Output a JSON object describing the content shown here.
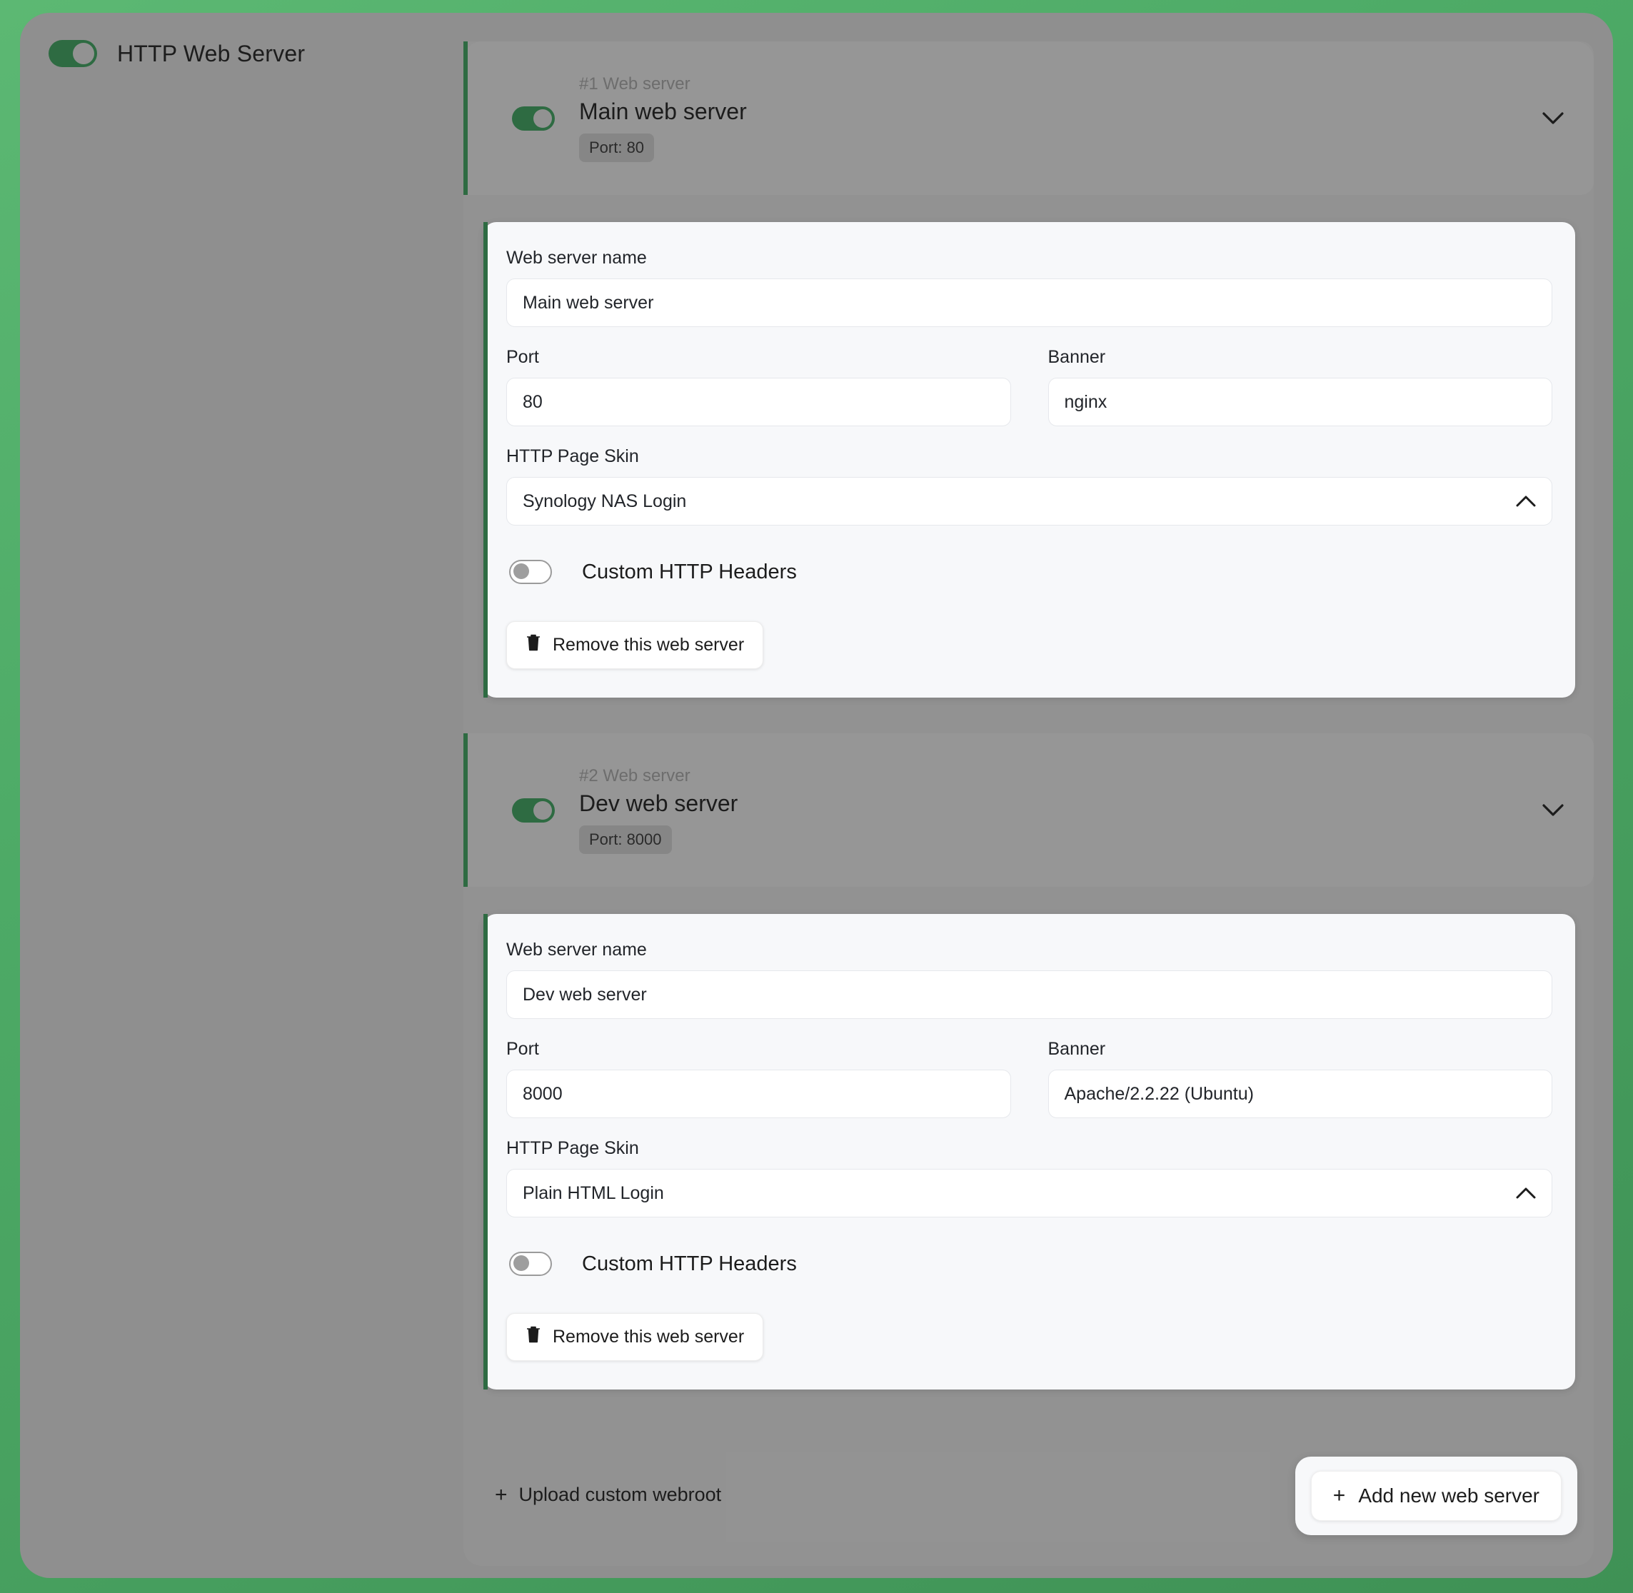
{
  "master": {
    "label": "HTTP Web Server",
    "enabled": true
  },
  "servers": [
    {
      "index_label": "#1 Web server",
      "name": "Main web server",
      "port_badge": "Port: 80",
      "enabled": true,
      "expanded": true,
      "collapse_icon": "chevron-down-icon",
      "form": {
        "name_label": "Web server name",
        "name_value": "Main web server",
        "port_label": "Port",
        "port_value": "80",
        "banner_label": "Banner",
        "banner_value": "nginx",
        "skin_label": "HTTP Page Skin",
        "skin_value": "Synology NAS Login",
        "skin_icon": "chevron-up-icon",
        "headers_label": "Custom HTTP Headers",
        "headers_enabled": false,
        "remove_label": "Remove this web server",
        "remove_icon": "trash-icon"
      }
    },
    {
      "index_label": "#2 Web server",
      "name": "Dev web server",
      "port_badge": "Port: 8000",
      "enabled": true,
      "expanded": true,
      "collapse_icon": "chevron-down-icon",
      "form": {
        "name_label": "Web server name",
        "name_value": "Dev web server",
        "port_label": "Port",
        "port_value": "8000",
        "banner_label": "Banner",
        "banner_value": "Apache/2.2.22 (Ubuntu)",
        "skin_label": "HTTP Page Skin",
        "skin_value": "Plain HTML Login",
        "skin_icon": "chevron-up-icon",
        "headers_label": "Custom HTTP Headers",
        "headers_enabled": false,
        "remove_label": "Remove this web server",
        "remove_icon": "trash-icon"
      }
    }
  ],
  "footer": {
    "upload_label": "Upload custom webroot",
    "upload_icon": "plus-icon",
    "add_label": "Add new web server",
    "add_icon": "plus-icon"
  },
  "colors": {
    "background_green": "#4daa66",
    "panel_grey": "#8f8f8f",
    "accent_green": "#2e6b42",
    "card_surface": "#f7f8fa",
    "input_surface": "#ffffff"
  }
}
